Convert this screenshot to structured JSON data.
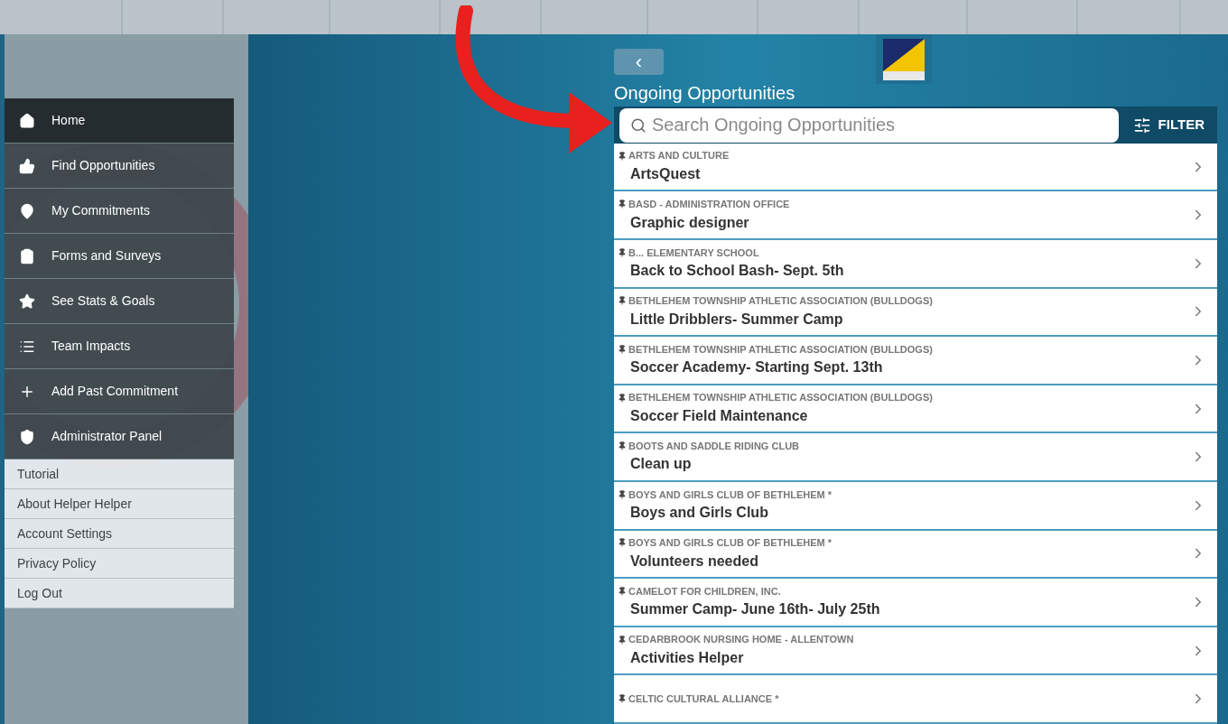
{
  "menu": [
    {
      "label": "Home",
      "selected": true
    },
    {
      "label": "Find Opportunities",
      "selected": false
    },
    {
      "label": "My Commitments",
      "selected": false
    },
    {
      "label": "Forms and Surveys",
      "selected": false
    },
    {
      "label": "See Stats & Goals",
      "selected": false
    },
    {
      "label": "Team Impacts",
      "selected": false
    },
    {
      "label": "Add Past Commitment",
      "selected": false
    },
    {
      "label": "Administrator Panel",
      "selected": false
    }
  ],
  "links": [
    "Tutorial",
    "About Helper Helper",
    "Account Settings",
    "Privacy Policy",
    "Log Out"
  ],
  "back_button": "‹",
  "title": "Ongoing Opportunities",
  "search": {
    "placeholder": "Search Ongoing Opportunities"
  },
  "filter_button": "FILTER",
  "opportunities": [
    {
      "category": "ARTS AND CULTURE",
      "name": "ArtsQuest"
    },
    {
      "category": "BASD - ADMINISTRATION OFFICE",
      "name": "Graphic designer"
    },
    {
      "category": "B... ELEMENTARY SCHOOL",
      "name": "Back to School Bash- Sept. 5th"
    },
    {
      "category": "BETHLEHEM TOWNSHIP ATHLETIC ASSOCIATION (BULLDOGS)",
      "name": "Little Dribblers- Summer Camp"
    },
    {
      "category": "BETHLEHEM TOWNSHIP ATHLETIC ASSOCIATION (BULLDOGS)",
      "name": "Soccer Academy- Starting Sept. 13th"
    },
    {
      "category": "BETHLEHEM TOWNSHIP ATHLETIC ASSOCIATION (BULLDOGS)",
      "name": "Soccer Field Maintenance"
    },
    {
      "category": "BOOTS AND SADDLE RIDING CLUB",
      "name": "Clean up"
    },
    {
      "category": "BOYS AND GIRLS CLUB OF BETHLEHEM *",
      "name": "Boys and Girls Club"
    },
    {
      "category": "BOYS AND GIRLS CLUB OF BETHLEHEM *",
      "name": "Volunteers needed"
    },
    {
      "category": "CAMELOT FOR CHILDREN, INC.",
      "name": "Summer Camp- June 16th- July 25th"
    },
    {
      "category": "CEDARBROOK NURSING HOME - ALLENTOWN",
      "name": "Activities Helper"
    },
    {
      "category": "CELTIC CULTURAL ALLIANCE *"
    }
  ]
}
